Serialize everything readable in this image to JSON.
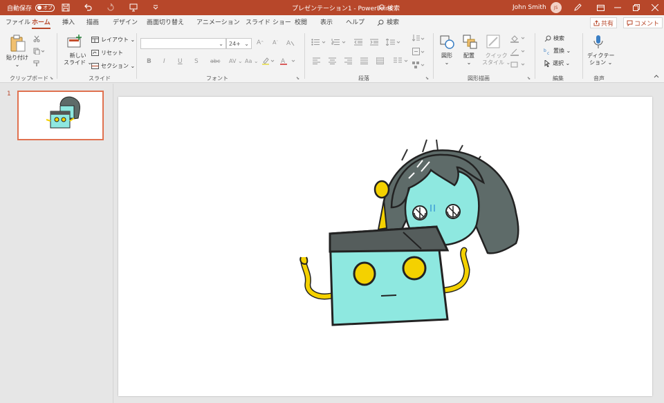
{
  "titlebar": {
    "autosave_label": "自動保存",
    "autosave_state": "オフ",
    "doc_title": "プレゼンテーション1  -  PowerPoint",
    "search_placeholder": "検索",
    "user_name": "John Smith",
    "user_initials": "JS"
  },
  "tabs": [
    "ファイル",
    "ホーム",
    "挿入",
    "描画",
    "デザイン",
    "画面切り替え",
    "アニメーション",
    "スライド ショー",
    "校閲",
    "表示",
    "ヘルプ"
  ],
  "tell_me": "検索",
  "share_label": "共有",
  "comment_label": "コメント",
  "ribbon": {
    "clipboard": {
      "paste_l1": "貼り付け",
      "paste_l2": "⌄",
      "group": "クリップボード"
    },
    "slides": {
      "new_l1": "新しい",
      "new_l2": "スライド ⌄",
      "layout": "レイアウト ⌄",
      "reset": "リセット",
      "section": "セクション ⌄",
      "group": "スライド"
    },
    "font": {
      "size": "24+",
      "group": "フォント",
      "bold": "B",
      "italic": "I",
      "underline": "U",
      "strike": "S",
      "spacing": "AV ⌄",
      "case": "Aa ⌄"
    },
    "paragraph": {
      "group": "段落"
    },
    "drawing": {
      "shapes": "図形",
      "arrange": "配置",
      "quick_l1": "クイック",
      "quick_l2": "スタイル ⌄",
      "group": "図形描画"
    },
    "editing": {
      "find": "検索",
      "replace": "置換 ⌄",
      "select": "選択 ⌄",
      "group": "編集"
    },
    "voice": {
      "dictate_l1": "ディクテー",
      "dictate_l2": "ション ⌄",
      "group": "音声"
    }
  },
  "slides_panel": {
    "number": "1"
  },
  "colors": {
    "accent": "#b7472a",
    "robot": "#8ee8e0",
    "hair": "#5e6b69",
    "yellow": "#f4d100"
  }
}
